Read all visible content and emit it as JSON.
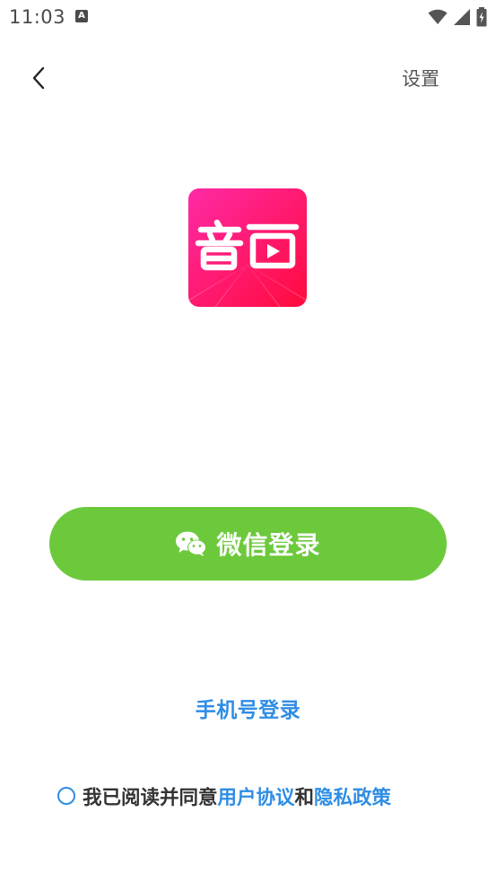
{
  "status_bar": {
    "time": "11:03",
    "notification_icon": "A"
  },
  "nav": {
    "back_icon": "chevron-left-icon",
    "settings_label": "设置"
  },
  "logo": {
    "text": "音画",
    "colors": {
      "gradient_start": "#ff2aa6",
      "gradient_end": "#ff0a3c"
    }
  },
  "wechat_login": {
    "label": "微信登录",
    "icon": "wechat-icon",
    "color": "#6cc93c"
  },
  "phone_login": {
    "label": "手机号登录"
  },
  "agreement": {
    "prefix": "我已阅读并同意",
    "user_agreement": "用户协议",
    "conjunction": "和",
    "privacy_policy": "隐私政策",
    "checked": false
  },
  "colors": {
    "accent": "#2f8de4",
    "text": "#333333"
  }
}
